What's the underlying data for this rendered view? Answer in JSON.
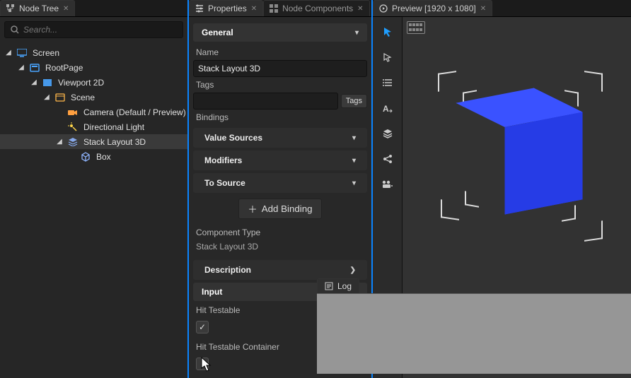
{
  "panels": {
    "node_tree_tab": "Node Tree",
    "properties_tab": "Properties",
    "node_components_tab": "Node Components",
    "preview_tab": "Preview [1920 x 1080]",
    "log_tab": "Log"
  },
  "search": {
    "placeholder": "Search..."
  },
  "tree": {
    "items": [
      {
        "label": "Screen",
        "icon": "screen",
        "indent": 0,
        "expanded": true
      },
      {
        "label": "RootPage",
        "icon": "page",
        "indent": 1,
        "expanded": true
      },
      {
        "label": "Viewport 2D",
        "icon": "viewport",
        "indent": 2,
        "expanded": true
      },
      {
        "label": "Scene",
        "icon": "scene",
        "indent": 3,
        "expanded": true
      },
      {
        "label": "Camera (Default / Preview)",
        "icon": "camera",
        "indent": 4,
        "expanded": false
      },
      {
        "label": "Directional Light",
        "icon": "light",
        "indent": 4,
        "expanded": false
      },
      {
        "label": "Stack Layout 3D",
        "icon": "stack",
        "indent": 4,
        "expanded": true,
        "selected": true
      },
      {
        "label": "Box",
        "icon": "box",
        "indent": 5,
        "expanded": false
      }
    ]
  },
  "properties": {
    "general": {
      "header": "General"
    },
    "name_label": "Name",
    "name_value": "Stack Layout 3D",
    "tags_label": "Tags",
    "tags_value": "",
    "tags_button": "Tags",
    "bindings_label": "Bindings",
    "bindings_groups": {
      "value_sources": "Value Sources",
      "modifiers": "Modifiers",
      "to_source": "To Source"
    },
    "add_binding": "Add Binding",
    "component_type_label": "Component Type",
    "component_type_value": "Stack Layout 3D",
    "description_header": "Description",
    "input_header": "Input",
    "hit_testable_label": "Hit Testable",
    "hit_testable_checked": true,
    "hit_testable_container_label": "Hit Testable Container",
    "hit_testable_container_checked": false
  },
  "toolbar": {
    "items": [
      {
        "name": "select-tool",
        "glyph": "pointer",
        "active": true
      },
      {
        "name": "move-tool",
        "glyph": "cursor",
        "active": false
      },
      {
        "name": "list-tool",
        "glyph": "list",
        "active": false
      },
      {
        "name": "text-tool",
        "glyph": "text",
        "active": false
      },
      {
        "name": "layers-tool",
        "glyph": "layers",
        "active": false
      },
      {
        "name": "share-tool",
        "glyph": "share",
        "active": false
      },
      {
        "name": "record-tool",
        "glyph": "record",
        "active": false
      }
    ]
  },
  "colors": {
    "accent": "#0a84ff",
    "cube_front": "#263ce6",
    "cube_top": "#3a52ff",
    "cube_right": "#1b2fc8"
  }
}
